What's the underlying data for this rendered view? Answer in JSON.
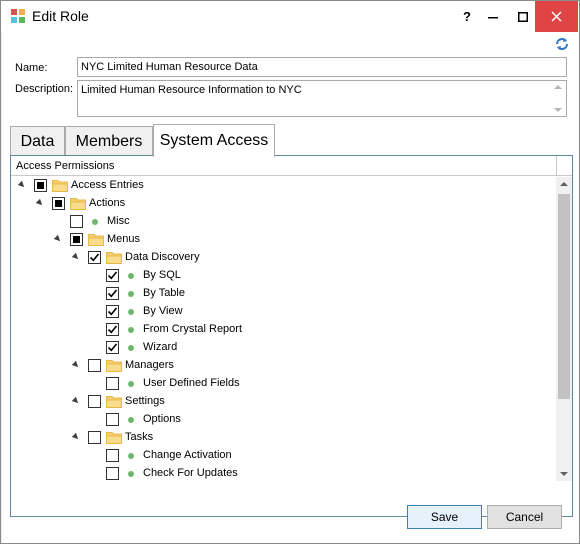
{
  "window": {
    "title": "Edit Role",
    "help_label": "?"
  },
  "form": {
    "name_label": "Name:",
    "name_value": "NYC Limited Human Resource Data",
    "description_label": "Description:",
    "description_value": "Limited Human Resource Information to NYC"
  },
  "tabs": [
    {
      "label": "Data",
      "selected": false
    },
    {
      "label": "Members",
      "selected": false
    },
    {
      "label": "System Access",
      "selected": true
    }
  ],
  "permissions": {
    "header": "Access Permissions",
    "items": [
      {
        "label": "Access Entries",
        "level": 0,
        "type": "folder",
        "check": "partial",
        "expanded": true
      },
      {
        "label": "Actions",
        "level": 1,
        "type": "folder",
        "check": "partial",
        "expanded": true
      },
      {
        "label": "Misc",
        "level": 2,
        "type": "leaf",
        "check": "unchecked"
      },
      {
        "label": "Menus",
        "level": 2,
        "type": "folder",
        "check": "partial",
        "expanded": true
      },
      {
        "label": "Data Discovery",
        "level": 3,
        "type": "folder",
        "check": "checked",
        "expanded": true
      },
      {
        "label": "By SQL",
        "level": 4,
        "type": "leaf",
        "check": "checked"
      },
      {
        "label": "By Table",
        "level": 4,
        "type": "leaf",
        "check": "checked"
      },
      {
        "label": "By View",
        "level": 4,
        "type": "leaf",
        "check": "checked"
      },
      {
        "label": "From Crystal Report",
        "level": 4,
        "type": "leaf",
        "check": "checked"
      },
      {
        "label": "Wizard",
        "level": 4,
        "type": "leaf",
        "check": "checked"
      },
      {
        "label": "Managers",
        "level": 3,
        "type": "folder",
        "check": "unchecked",
        "expanded": true
      },
      {
        "label": "User Defined Fields",
        "level": 4,
        "type": "leaf",
        "check": "unchecked"
      },
      {
        "label": "Settings",
        "level": 3,
        "type": "folder",
        "check": "unchecked",
        "expanded": true
      },
      {
        "label": "Options",
        "level": 4,
        "type": "leaf",
        "check": "unchecked"
      },
      {
        "label": "Tasks",
        "level": 3,
        "type": "folder",
        "check": "unchecked",
        "expanded": true
      },
      {
        "label": "Change Activation",
        "level": 4,
        "type": "leaf",
        "check": "unchecked"
      },
      {
        "label": "Check For Updates",
        "level": 4,
        "type": "leaf",
        "check": "unchecked"
      }
    ]
  },
  "buttons": {
    "save": "Save",
    "cancel": "Cancel"
  },
  "colors": {
    "close_button": "#e04343",
    "accent_border": "#3c7fb1",
    "folder": "#e8b84a",
    "leaf_dot": "#6fb56b"
  },
  "icons": {
    "app": "edit-role-app-icon",
    "refresh": "refresh-icon",
    "folder": "folder-icon",
    "leaf": "green-dot-icon"
  }
}
